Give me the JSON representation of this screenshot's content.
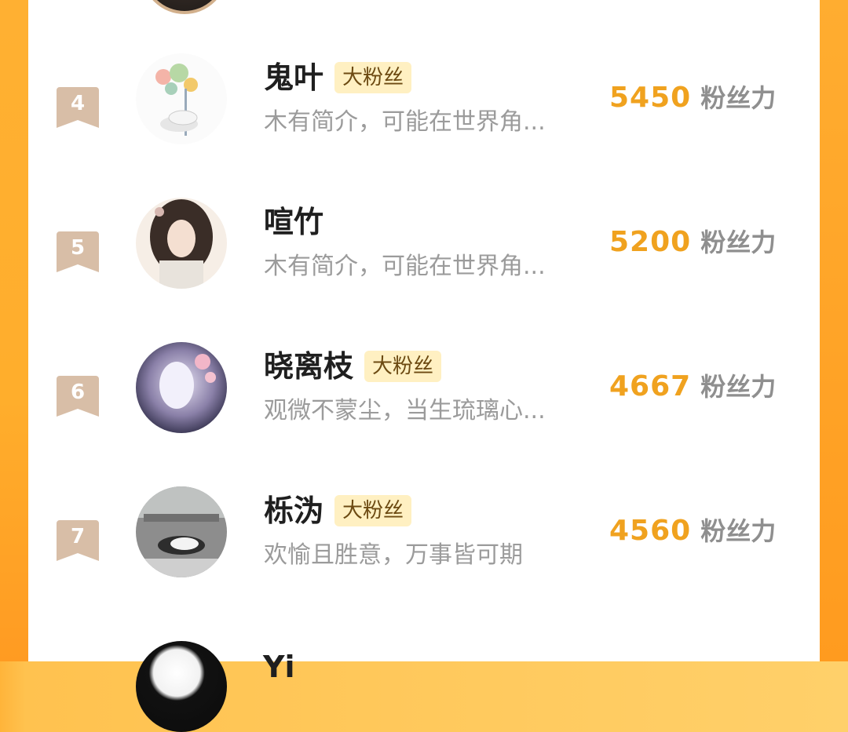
{
  "accent": "#f0a21f",
  "tag_bg": "#fff0c2",
  "rows": [
    {
      "rank": "4",
      "name": "鬼叶",
      "tag": "大粉丝",
      "bio": "木有简介，可能在世界角...",
      "score": "5450",
      "score_unit": "粉丝力",
      "avatar_icon": "avatar-cat-flowers"
    },
    {
      "rank": "5",
      "name": "喧竹",
      "tag": "",
      "bio": "木有简介，可能在世界角...",
      "score": "5200",
      "score_unit": "粉丝力",
      "avatar_icon": "avatar-anime-character"
    },
    {
      "rank": "6",
      "name": "晓离枝",
      "tag": "大粉丝",
      "bio": "观微不蒙尘，当生琉璃心...",
      "score": "4667",
      "score_unit": "粉丝力",
      "avatar_icon": "avatar-anime-girl"
    },
    {
      "rank": "7",
      "name": "栎沩",
      "tag": "大粉丝",
      "bio": "欢愉且胜意，万事皆可期",
      "score": "4560",
      "score_unit": "粉丝力",
      "avatar_icon": "avatar-cat-photo"
    }
  ],
  "next_row_name": "Yi"
}
